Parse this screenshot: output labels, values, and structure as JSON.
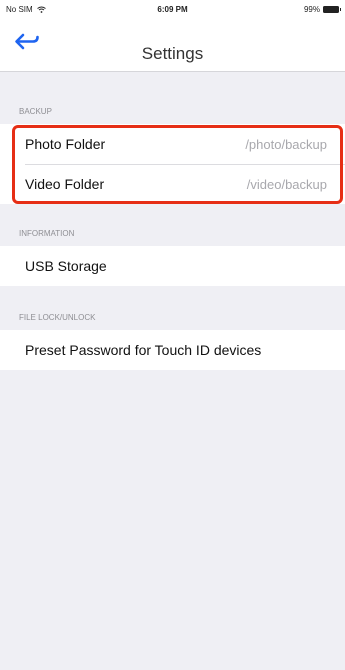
{
  "status_bar": {
    "carrier": "No SIM",
    "time": "6:09 PM",
    "battery": "99%"
  },
  "nav": {
    "title": "Settings",
    "back_icon": "back-arrow-icon"
  },
  "sections": {
    "backup": {
      "header": "BACKUP",
      "rows": [
        {
          "label": "Photo Folder",
          "value": "/photo/backup"
        },
        {
          "label": "Video Folder",
          "value": "/video/backup"
        }
      ]
    },
    "information": {
      "header": "INFORMATION",
      "rows": [
        {
          "label": "USB Storage"
        }
      ]
    },
    "file_lock": {
      "header": "FILE LOCK/UNLOCK",
      "rows": [
        {
          "label": "Preset Password for Touch ID devices"
        }
      ]
    }
  },
  "colors": {
    "accent": "#1e64f0",
    "highlight": "#e62e15",
    "background": "#efeff4"
  }
}
